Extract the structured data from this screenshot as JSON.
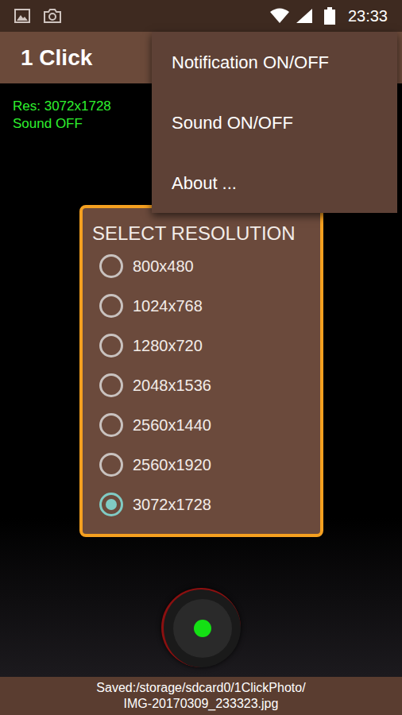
{
  "status_bar": {
    "time": "23:33"
  },
  "app_bar": {
    "title": "1 Click"
  },
  "overlay": {
    "resolution": "Res: 3072x1728",
    "sound": "Sound OFF"
  },
  "menu": {
    "items": [
      "Notification ON/OFF",
      "Sound ON/OFF",
      "About ..."
    ]
  },
  "dialog": {
    "title": "SELECT RESOLUTION",
    "options": [
      {
        "label": "800x480",
        "selected": false
      },
      {
        "label": "1024x768",
        "selected": false
      },
      {
        "label": "1280x720",
        "selected": false
      },
      {
        "label": "2048x1536",
        "selected": false
      },
      {
        "label": "2560x1440",
        "selected": false
      },
      {
        "label": "2560x1920",
        "selected": false
      },
      {
        "label": "3072x1728",
        "selected": true
      }
    ]
  },
  "footer": {
    "lines": [
      "Saved:/storage/sdcard0/1ClickPhoto/",
      "IMG-20170309_233323.jpg"
    ]
  }
}
